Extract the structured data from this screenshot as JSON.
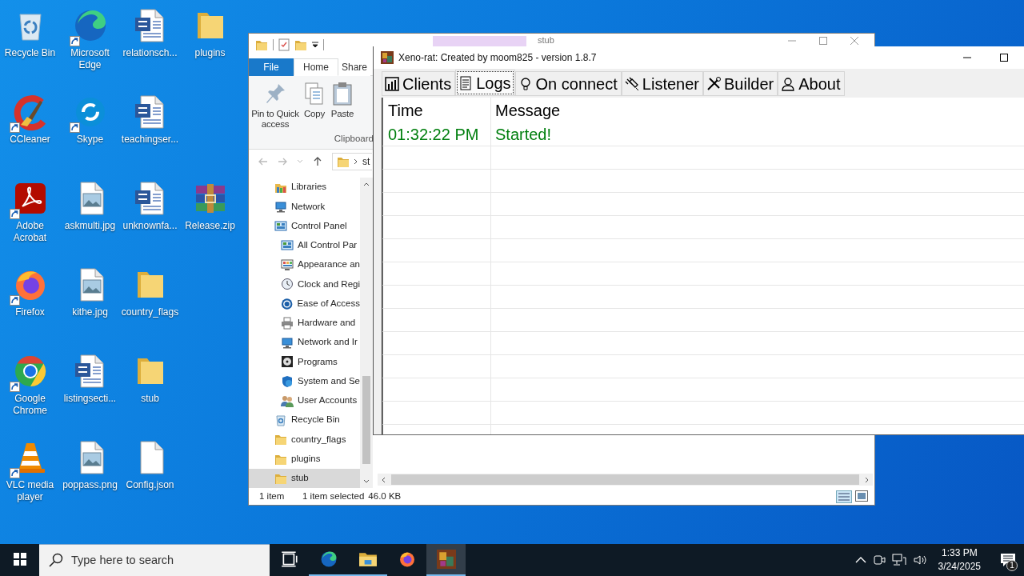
{
  "desktop_icons": [
    [
      {
        "label": "Recycle Bin",
        "kind": "recycle",
        "shortcut": false
      },
      {
        "label": "Microsoft Edge",
        "kind": "edge",
        "shortcut": true
      },
      {
        "label": "relationsch...",
        "kind": "word",
        "shortcut": false
      },
      {
        "label": "plugins",
        "kind": "folder",
        "shortcut": false
      }
    ],
    [
      {
        "label": "CCleaner",
        "kind": "ccleaner",
        "shortcut": true
      },
      {
        "label": "Skype",
        "kind": "skype",
        "shortcut": true
      },
      {
        "label": "teachingser...",
        "kind": "word",
        "shortcut": false
      }
    ],
    [
      {
        "label": "Adobe Acrobat",
        "kind": "acrobat",
        "shortcut": true
      },
      {
        "label": "askmulti.jpg",
        "kind": "image",
        "shortcut": false
      },
      {
        "label": "unknownfa...",
        "kind": "word",
        "shortcut": false
      },
      {
        "label": "Release.zip",
        "kind": "archive",
        "shortcut": false
      }
    ],
    [
      {
        "label": "Firefox",
        "kind": "firefox",
        "shortcut": true
      },
      {
        "label": "kithe.jpg",
        "kind": "image",
        "shortcut": false
      },
      {
        "label": "country_flags",
        "kind": "folder",
        "shortcut": false
      }
    ],
    [
      {
        "label": "Google Chrome",
        "kind": "chrome",
        "shortcut": true
      },
      {
        "label": "listingsecti...",
        "kind": "word",
        "shortcut": false
      },
      {
        "label": "stub",
        "kind": "folder",
        "shortcut": false
      }
    ],
    [
      {
        "label": "VLC media player",
        "kind": "vlc",
        "shortcut": true
      },
      {
        "label": "poppass.png",
        "kind": "image",
        "shortcut": false
      },
      {
        "label": "Config.json",
        "kind": "file",
        "shortcut": false
      }
    ]
  ],
  "explorer": {
    "title": "stub",
    "ribbon_tabs": [
      {
        "label": "File",
        "kind": "menu",
        "selected": false
      },
      {
        "label": "Home",
        "kind": "tab",
        "selected": true
      },
      {
        "label": "Share",
        "kind": "tab",
        "selected": false
      }
    ],
    "ribbon_buttons": [
      {
        "label": "Pin to Quick access",
        "kind": "pin"
      },
      {
        "label": "Copy",
        "kind": "copy"
      },
      {
        "label": "Paste",
        "kind": "paste"
      }
    ],
    "ribbon_group": "Clipboard",
    "address": "st",
    "nav_tree": [
      {
        "label": "Libraries",
        "kind": "libraries",
        "selected": false
      },
      {
        "label": "Network",
        "kind": "network",
        "selected": false
      },
      {
        "label": "Control Panel",
        "kind": "control",
        "selected": false,
        "children": [
          {
            "label": "All Control Par",
            "kind": "control",
            "selected": false
          },
          {
            "label": "Appearance an",
            "kind": "appearance",
            "selected": false
          },
          {
            "label": "Clock and Regi",
            "kind": "clock",
            "selected": false
          },
          {
            "label": "Ease of Access",
            "kind": "ease",
            "selected": false
          },
          {
            "label": "Hardware and",
            "kind": "hardware",
            "selected": false
          },
          {
            "label": "Network and Ir",
            "kind": "network",
            "selected": false
          },
          {
            "label": "Programs",
            "kind": "programs",
            "selected": false
          },
          {
            "label": "System and Se",
            "kind": "system",
            "selected": false
          },
          {
            "label": "User Accounts",
            "kind": "users",
            "selected": false
          }
        ]
      },
      {
        "label": "Recycle Bin",
        "kind": "recycle",
        "selected": false
      },
      {
        "label": "country_flags",
        "kind": "folder",
        "selected": false
      },
      {
        "label": "plugins",
        "kind": "folder",
        "selected": false
      },
      {
        "label": "stub",
        "kind": "folder",
        "selected": true
      }
    ],
    "status": {
      "count": "1 item",
      "selection": "1 item selected",
      "size": "46.0 KB"
    }
  },
  "xeno": {
    "title": "Xeno-rat: Created by moom825 - version 1.8.7",
    "tabs": [
      {
        "label": "Clients",
        "kind": "chart",
        "selected": false
      },
      {
        "label": "Logs",
        "kind": "log",
        "selected": true
      },
      {
        "label": "On connect",
        "kind": "bulb",
        "selected": false
      },
      {
        "label": "Listener",
        "kind": "plug",
        "selected": false
      },
      {
        "label": "Builder",
        "kind": "tools",
        "selected": false
      },
      {
        "label": "About",
        "kind": "user",
        "selected": false
      }
    ],
    "log": {
      "columns": [
        "Time",
        "Message"
      ],
      "rows": [
        {
          "time": "01:32:22 PM",
          "message": "Started!"
        }
      ]
    }
  },
  "taskbar": {
    "search_placeholder": "Type here to search",
    "apps": [
      {
        "kind": "taskview",
        "running": false,
        "active": false
      },
      {
        "kind": "edge",
        "running": true,
        "active": false
      },
      {
        "kind": "explorer",
        "running": true,
        "active": false
      },
      {
        "kind": "firefox",
        "running": false,
        "active": false
      },
      {
        "kind": "xeno",
        "running": true,
        "active": true
      }
    ],
    "time": "1:33 PM",
    "date": "3/24/2025",
    "notification_count": "1"
  }
}
